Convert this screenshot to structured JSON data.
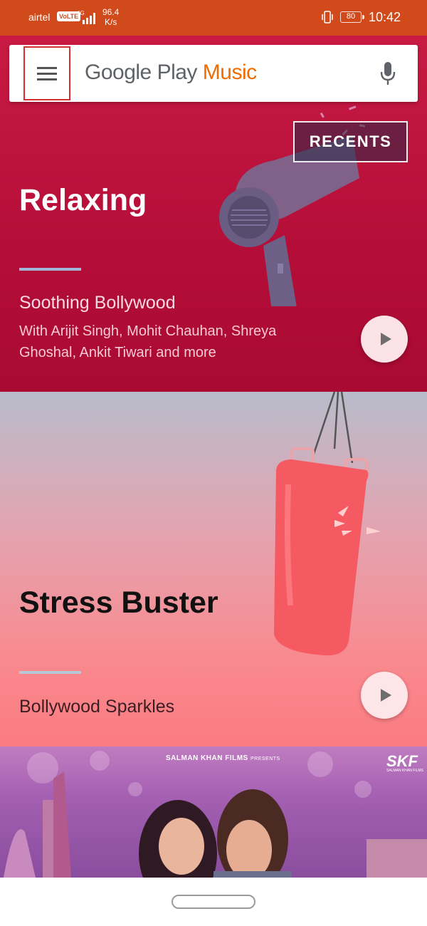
{
  "status_bar": {
    "carrier": "airtel",
    "volte": "VoLTE",
    "network": "4G",
    "speed_value": "96.4",
    "speed_unit": "K/s",
    "battery": "80",
    "time": "10:42"
  },
  "search_bar": {
    "logo_google": "Google Play",
    "logo_music": "Music"
  },
  "sections": [
    {
      "title": "Relaxing",
      "playlist": "Soothing Bollywood",
      "description": "With Arijit Singh, Mohit Chauhan, Shreya Ghoshal, Ankit Tiwari and more",
      "recents_label": "RECENTS"
    },
    {
      "title": "Stress Buster",
      "playlist": "Bollywood Sparkles"
    },
    {
      "banner_presents": "SALMAN KHAN FILMS",
      "banner_presents_suffix": "PRESENTS",
      "banner_logo": "SKF",
      "banner_logo_sub": "SALMAN KHAN FILMS"
    }
  ],
  "colors": {
    "status_bar": "#d04a1c",
    "relaxing_bg": "#c81a43",
    "stress_bg_bottom": "#fb7b81",
    "music_accent": "#ef6c00",
    "menu_highlight": "#d83030"
  }
}
